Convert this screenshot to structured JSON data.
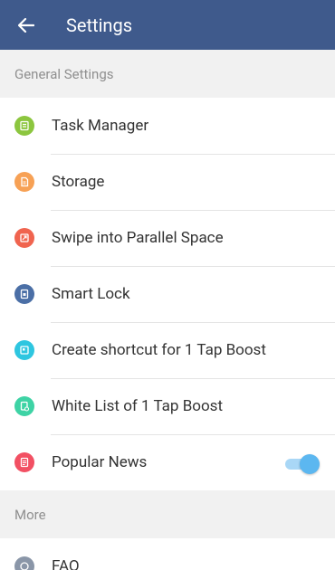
{
  "appbar": {
    "title": "Settings",
    "back_icon": "arrow-left-icon",
    "color": "#3f5a8c"
  },
  "sections": {
    "general": "General Settings",
    "more": "More"
  },
  "items": [
    {
      "label": "Task Manager",
      "icon": "task-manager-icon",
      "color": "#8cc63f"
    },
    {
      "label": "Storage",
      "icon": "storage-icon",
      "color": "#f7a155"
    },
    {
      "label": "Swipe into Parallel Space",
      "icon": "swipe-icon",
      "color": "#f0644f"
    },
    {
      "label": "Smart Lock",
      "icon": "lock-icon",
      "color": "#4b6fa6"
    },
    {
      "label": "Create shortcut for 1 Tap Boost",
      "icon": "shortcut-icon",
      "color": "#2ec6e0"
    },
    {
      "label": "White List of 1 Tap Boost",
      "icon": "whitelist-icon",
      "color": "#3ed3a5"
    },
    {
      "label": "Popular News",
      "icon": "news-icon",
      "color": "#f25063",
      "toggle_on": true
    }
  ],
  "more_items": [
    {
      "label": "FAQ",
      "icon": "faq-icon",
      "color": "#8a96a8"
    }
  ]
}
